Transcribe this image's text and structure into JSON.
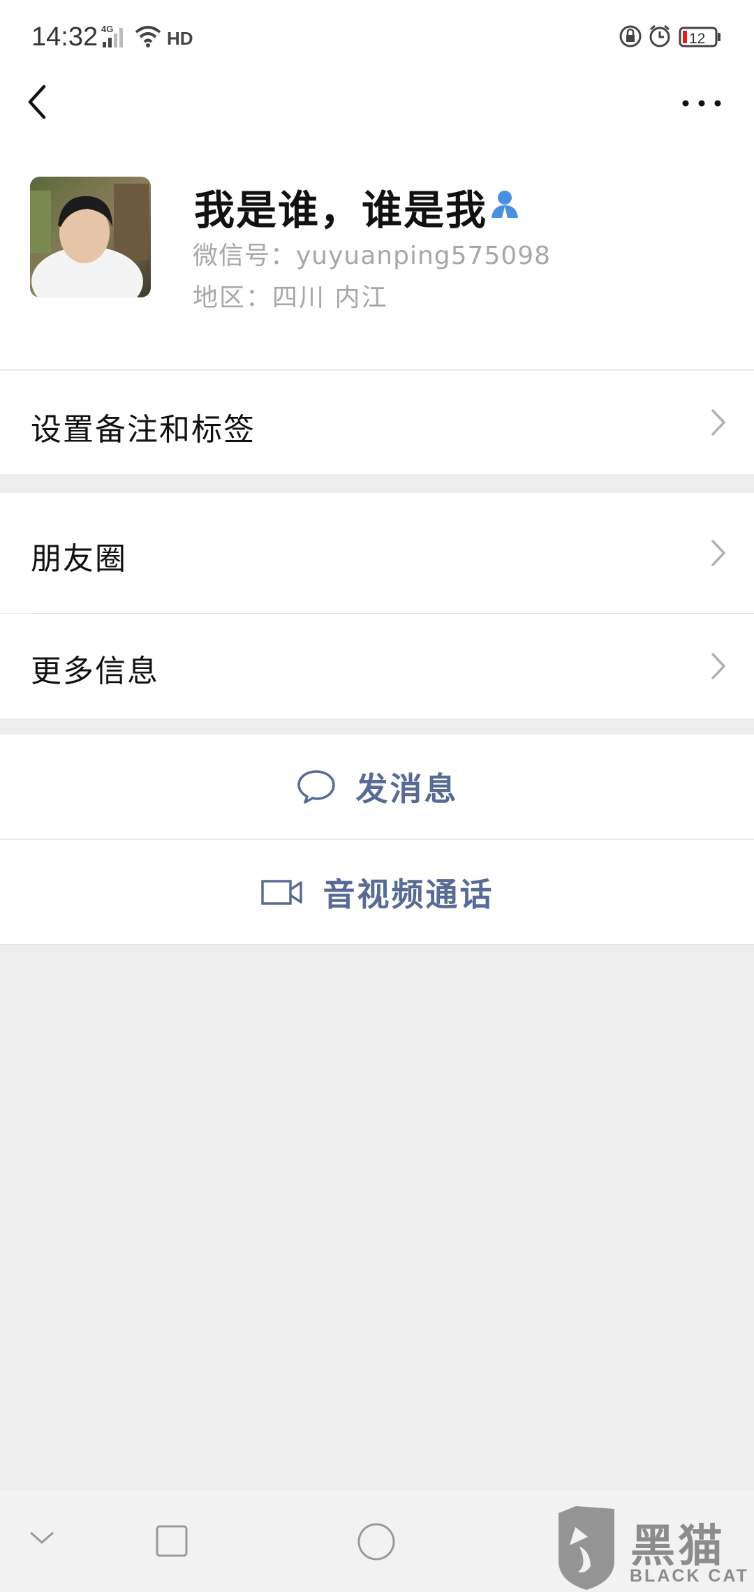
{
  "status_bar": {
    "time": "14:32",
    "network": "4G",
    "hd": "HD",
    "battery": "12"
  },
  "header": {
    "back_icon": "chevron-left-icon",
    "more_icon": "more-dots-icon"
  },
  "profile": {
    "nickname": "我是谁，谁是我",
    "wechat_id": "微信号：yuyuanping575098",
    "region": "地区：四川 内江"
  },
  "rows": {
    "remark": "设置备注和标签",
    "moments": "朋友圈",
    "more_info": "更多信息"
  },
  "actions": {
    "send_message": "发消息",
    "video_call": "音视频通话"
  },
  "watermark": {
    "text": "黑猫",
    "sub": "BLACK CAT"
  },
  "colors": {
    "link_blue": "#576b95",
    "badge_blue": "#4a90e2",
    "background": "#ededed",
    "battery_red": "#e02020"
  }
}
